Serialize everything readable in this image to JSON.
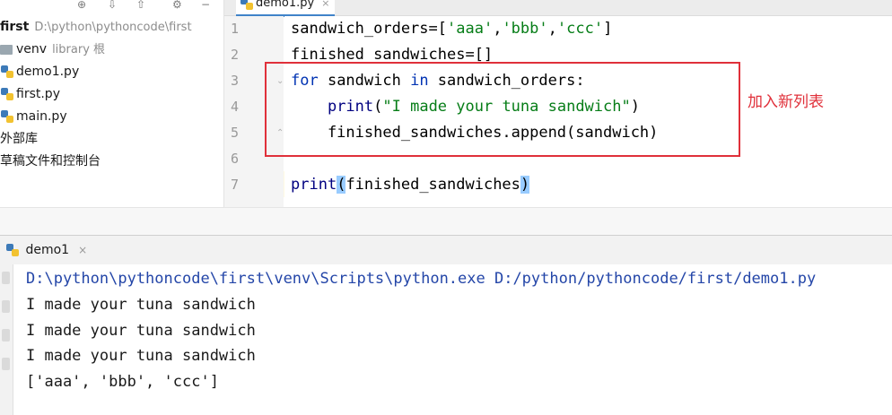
{
  "project": {
    "root_name": "first",
    "root_path": "D:\\python\\pythoncode\\first",
    "items": [
      {
        "name": "venv",
        "hint": "library 根",
        "icon": "folder-icon"
      },
      {
        "name": "demo1.py",
        "icon": "python-file-icon"
      },
      {
        "name": "first.py",
        "icon": "python-file-icon"
      },
      {
        "name": "main.py",
        "icon": "python-file-icon"
      }
    ],
    "external_libraries": "外部库",
    "scratches": "草稿文件和控制台"
  },
  "editor_tab": {
    "label": "demo1.py",
    "close": "×"
  },
  "editor": {
    "line_numbers": [
      "1",
      "2",
      "3",
      "4",
      "5",
      "6",
      "7"
    ],
    "code": {
      "l1_var": "sandwich_orders=[",
      "l1_s1": "'aaa'",
      "l1_c1": ",",
      "l1_s2": "'bbb'",
      "l1_c2": ",",
      "l1_s3": "'ccc'",
      "l1_end": "]",
      "l2": "finished_sandwiches=[]",
      "l3_kw1": "for",
      "l3_mid": " sandwich ",
      "l3_kw2": "in",
      "l3_end": " sandwich_orders:",
      "l4_indent": "    ",
      "l4_fn": "print",
      "l4_open": "(",
      "l4_str": "\"I made your tuna sandwich\"",
      "l4_close": ")",
      "l5": "    finished_sandwiches.append(sandwich)",
      "l7_fn": "print",
      "l7_open": "(",
      "l7_arg": "finished_sandwiches",
      "l7_close": ")"
    },
    "annotation": "加入新列表"
  },
  "run": {
    "tab_label": "demo1",
    "close": "×",
    "output": [
      "D:\\python\\pythoncode\\first\\venv\\Scripts\\python.exe D:/python/pythoncode/first/demo1.py",
      "I made your tuna sandwich",
      "I made your tuna sandwich",
      "I made your tuna sandwich",
      "['aaa', 'bbb', 'ccc']"
    ]
  },
  "colors": {
    "keyword": "#0033b3",
    "string": "#067d17",
    "annotation_red": "#e0303a",
    "console_command": "#2446a8"
  }
}
